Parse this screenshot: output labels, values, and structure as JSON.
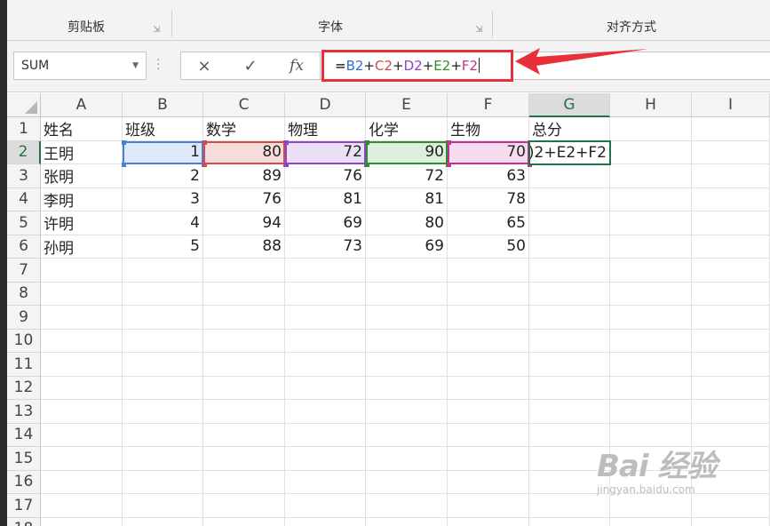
{
  "ribbon": {
    "groups": [
      "剪贴板",
      "字体",
      "对齐方式"
    ]
  },
  "formula_bar": {
    "name_box": "SUM",
    "cancel_icon": "×",
    "enter_icon": "✓",
    "fx_label": "fx",
    "formula": {
      "eq": "=",
      "parts": [
        {
          "text": "B2",
          "color": "#2f6fcf"
        },
        {
          "text": "+",
          "color": "#222222"
        },
        {
          "text": "C2",
          "color": "#d24a4a"
        },
        {
          "text": "+",
          "color": "#222222"
        },
        {
          "text": "D2",
          "color": "#8e44c9"
        },
        {
          "text": "+",
          "color": "#222222"
        },
        {
          "text": "E2",
          "color": "#2c8f2c"
        },
        {
          "text": "+",
          "color": "#222222"
        },
        {
          "text": "F2",
          "color": "#c2328f"
        }
      ]
    },
    "highlight_color": "#e8303a"
  },
  "sheet": {
    "columns": [
      "A",
      "B",
      "C",
      "D",
      "E",
      "F",
      "G",
      "H",
      "I"
    ],
    "rows": [
      "1",
      "2",
      "3",
      "4",
      "5",
      "6",
      "7",
      "8",
      "9",
      "10",
      "11",
      "12",
      "13",
      "14",
      "15",
      "16",
      "17",
      "18"
    ],
    "selected_column": "G",
    "selected_row": "2",
    "header_row": [
      "姓名",
      "班级",
      "数学",
      "物理",
      "化学",
      "生物",
      "总分"
    ],
    "data_rows": [
      [
        "王明",
        "1",
        "80",
        "72",
        "90",
        "70"
      ],
      [
        "张明",
        "2",
        "89",
        "76",
        "72",
        "63"
      ],
      [
        "李明",
        "3",
        "76",
        "81",
        "81",
        "78"
      ],
      [
        "许明",
        "4",
        "94",
        "69",
        "80",
        "65"
      ],
      [
        "孙明",
        "5",
        "88",
        "73",
        "69",
        "50"
      ]
    ],
    "active_cell_text": ")2+E2+F2",
    "reference_colors": {
      "B": {
        "border": "#4a7fd6",
        "fill": "#dde8f8"
      },
      "C": {
        "border": "#d24a4a",
        "fill": "#f7dcdc"
      },
      "D": {
        "border": "#8e44c9",
        "fill": "#ece0f6"
      },
      "E": {
        "border": "#2c8f2c",
        "fill": "#dcefdc"
      },
      "F": {
        "border": "#c2328f",
        "fill": "#f6dcee"
      }
    }
  },
  "watermark": {
    "brand": "Bai 经验",
    "url": "jingyan.baidu.com"
  }
}
